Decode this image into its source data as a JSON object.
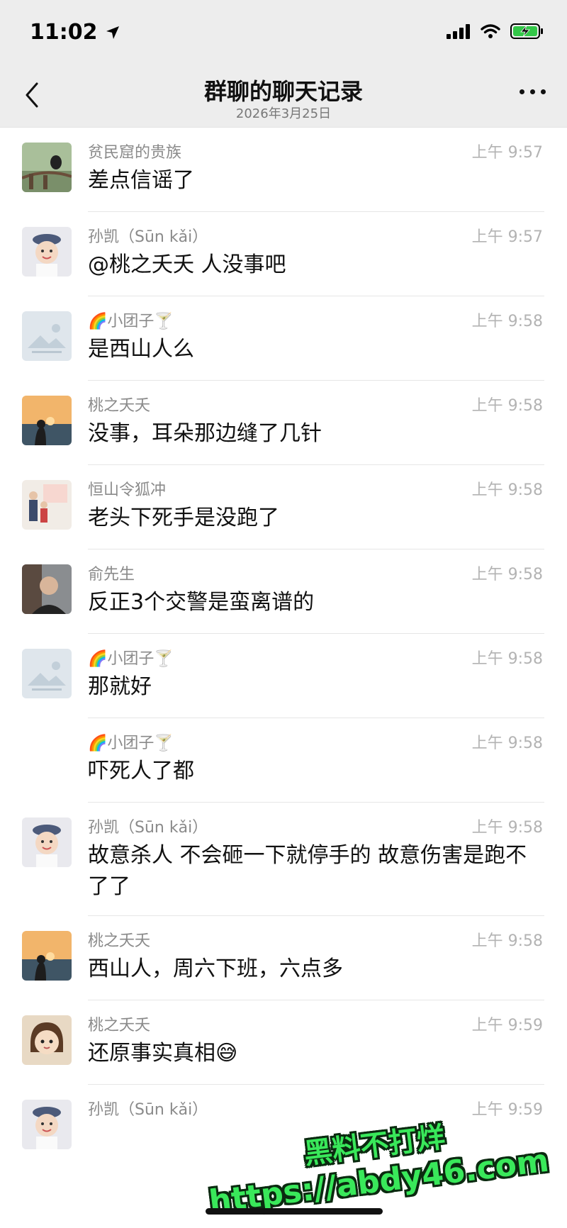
{
  "status": {
    "time": "11:02"
  },
  "nav": {
    "title": "群聊的聊天记录",
    "subtitle": "2026年3月25日"
  },
  "messages": [
    {
      "sender": "贫民窟的贵族",
      "time": "上午 9:57",
      "text": "差点信谣了",
      "avatar": "bird-avatar",
      "avatar_color": "#7a8f6a"
    },
    {
      "sender": "孙凯（Sūn kǎi）",
      "time": "上午 9:57",
      "text": "@桃之夭夭 人没事吧",
      "avatar": "baby-avatar",
      "avatar_color": "#e9e9ee"
    },
    {
      "sender": "🌈小团子🍸",
      "time": "上午 9:58",
      "text": "是西山人么",
      "avatar": "placeholder-avatar",
      "avatar_color": "#dfe6ec"
    },
    {
      "sender": "桃之夭夭",
      "time": "上午 9:58",
      "text": "没事，耳朵那边缝了几针",
      "avatar": "sunset-avatar",
      "avatar_color": "#3f5565"
    },
    {
      "sender": "恒山令狐冲",
      "time": "上午 9:58",
      "text": "老头下死手是没跑了",
      "avatar": "family-avatar",
      "avatar_color": "#f1ece6"
    },
    {
      "sender": "俞先生",
      "time": "上午 9:58",
      "text": "反正3个交警是蛮离谱的",
      "avatar": "man-avatar",
      "avatar_color": "#5a4a40"
    },
    {
      "sender": "🌈小团子🍸",
      "time": "上午 9:58",
      "text": "那就好",
      "avatar": "placeholder-avatar",
      "avatar_color": "#dfe6ec"
    },
    {
      "sender": "🌈小团子🍸",
      "time": "上午 9:58",
      "text": "吓死人了都",
      "avatar": "",
      "avatar_color": ""
    },
    {
      "sender": "孙凯（Sūn kǎi）",
      "time": "上午 9:58",
      "text": "故意杀人  不会砸一下就停手的        故意伤害是跑不了了",
      "avatar": "baby-avatar",
      "avatar_color": "#e9e9ee"
    },
    {
      "sender": "桃之夭夭",
      "time": "上午 9:58",
      "text": "西山人，周六下班，六点多",
      "avatar": "sunset-avatar",
      "avatar_color": "#3f5565"
    },
    {
      "sender": "桃之夭夭",
      "time": "上午 9:59",
      "text": "还原事实真相😅",
      "avatar": "cartoon-avatar",
      "avatar_color": "#e8d9c4"
    },
    {
      "sender": "孙凯（Sūn kǎi）",
      "time": "上午 9:59",
      "text": "",
      "avatar": "baby-avatar",
      "avatar_color": "#e9e9ee"
    }
  ],
  "watermark": {
    "line1": "黑料不打烊",
    "line2": "https://abdy46.com"
  }
}
